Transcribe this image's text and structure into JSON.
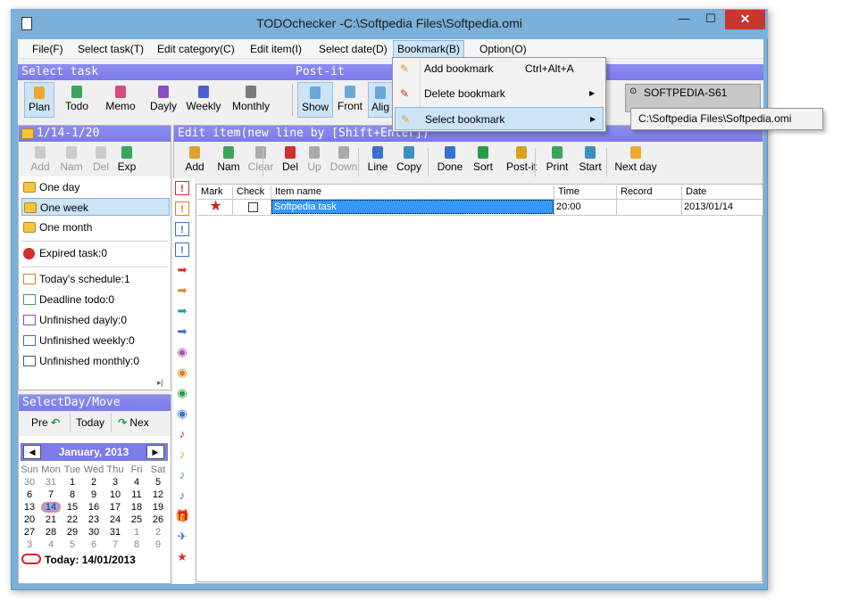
{
  "window": {
    "title": "TODOchecker -C:\\Softpedia Files\\Softpedia.omi",
    "minimize": "—",
    "maximize": "☐",
    "close": "✕"
  },
  "menu": [
    "File(F)",
    "Select task(T)",
    "Edit category(C)",
    "Edit item(I)",
    "Select date(D)",
    "Bookmark(B)",
    "Option(O)"
  ],
  "select_task": {
    "header": "Select task",
    "buttons": [
      "Plan",
      "Todo",
      "Memo",
      "Dayly",
      "Weekly",
      "Monthly"
    ]
  },
  "postit": {
    "header": "Post-it config/",
    "buttons": [
      "Show",
      "Front",
      "Alig"
    ]
  },
  "bookmark_box": "SOFTPEDIA-S61",
  "date_panel": {
    "header": "1/14-1/20",
    "toolbar": [
      "Add",
      "Nam",
      "Del",
      "Exp"
    ],
    "ranges": [
      "One day",
      "One week",
      "One month"
    ],
    "expired": "Expired task:0",
    "stats": [
      "Today's schedule:1",
      "Deadline todo:0",
      "Unfinished dayly:0",
      "Unfinished weekly:0",
      "Unfinished monthly:0"
    ]
  },
  "edit_item": {
    "header": "Edit item(new line by [Shift+Enter])",
    "toolbar": [
      "Add",
      "Nam",
      "Clear",
      "Del",
      "Up",
      "Down",
      "Line",
      "Copy",
      "Done",
      "Sort",
      "Post-it",
      "Print",
      "Start",
      "Next day"
    ]
  },
  "grid": {
    "columns": [
      "Mark",
      "Check",
      "Item name",
      "Time",
      "Record",
      "Date"
    ],
    "rows": [
      {
        "mark": "★",
        "check": "",
        "item": "Softpedia task",
        "time": "20:00",
        "record": "",
        "date": "2013/01/14"
      }
    ]
  },
  "mark_icons": [
    "!",
    "!",
    "!",
    "!",
    "➡",
    "➡",
    "➡",
    "➡",
    "◉",
    "◉",
    "◉",
    "◉",
    "♪",
    "♪",
    "♪",
    "♪",
    "🎁",
    "✈",
    "★"
  ],
  "select_day": {
    "header": "SelectDay/Move",
    "prev": "Pre",
    "today": "Today",
    "next": "Nex",
    "month": "January, 2013",
    "weekdays": [
      "Sun",
      "Mon",
      "Tue",
      "Wed",
      "Thu",
      "Fri",
      "Sat"
    ],
    "weeks": [
      [
        "30",
        "31",
        "1",
        "2",
        "3",
        "4",
        "5"
      ],
      [
        "6",
        "7",
        "8",
        "9",
        "10",
        "11",
        "12"
      ],
      [
        "13",
        "14",
        "15",
        "16",
        "17",
        "18",
        "19"
      ],
      [
        "20",
        "21",
        "22",
        "23",
        "24",
        "25",
        "26"
      ],
      [
        "27",
        "28",
        "29",
        "30",
        "31",
        "1",
        "2"
      ],
      [
        "3",
        "4",
        "5",
        "6",
        "7",
        "8",
        "9"
      ]
    ],
    "today_label": "Today: 14/01/2013"
  },
  "bookmark_menu": {
    "items": [
      {
        "label": "Add bookmark",
        "shortcut": "Ctrl+Alt+A",
        "arrow": ""
      },
      {
        "label": "Delete bookmark",
        "shortcut": "",
        "arrow": "▶"
      },
      {
        "label": "Select bookmark",
        "shortcut": "",
        "arrow": "▶"
      }
    ],
    "submenu": "C:\\Softpedia Files\\Softpedia.omi"
  },
  "colors": {
    "accent": "#7b7bea",
    "titlebar": "#7ab0d9",
    "close": "#c7372f",
    "selection": "#cde4f7"
  }
}
